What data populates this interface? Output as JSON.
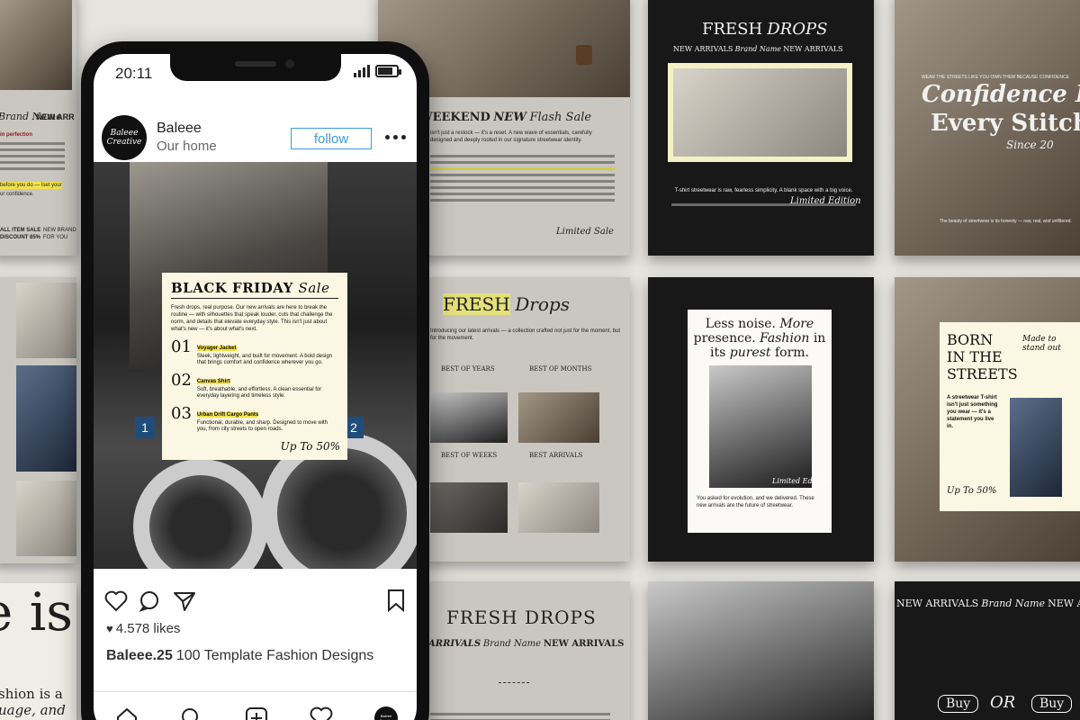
{
  "colors": {
    "accent": "#3d9be0",
    "highlight": "#f3e14b",
    "card": "#fbf7e2",
    "dark": "#181818"
  },
  "phone": {
    "time": "20:11",
    "account": {
      "name": "Baleee",
      "sub": "Our home",
      "avatar_text": "Baleee Creative",
      "follow": "follow"
    },
    "post": {
      "card_title": "BLACK FRIDAY",
      "card_title_script": "Sale",
      "intro": "Fresh drops, real purpose. Our new arrivals are here to break the routine — with silhouettes that speak louder, cuts that challenge the norm, and details that elevate everyday style. This isn't just about what's new — it's about what's next.",
      "items": [
        {
          "num": "01",
          "title": "Voyager Jacket",
          "desc": "Sleek, lightweight, and built for movement. A bold design that brings comfort and confidence wherever you go."
        },
        {
          "num": "02",
          "title": "Canvas Shirt",
          "desc": "Soft, breathable, and effortless. A clean essential for everyday layering and timeless style."
        },
        {
          "num": "03",
          "title": "Urban Drift Cargo Pants",
          "desc": "Functional, durable, and sharp. Designed to move with you, from city streets to open roads."
        }
      ],
      "upto": "Up To 50%",
      "badge_left": "1",
      "badge_right": "2"
    },
    "likes": "4.578 likes",
    "caption_user": "Baleee.25",
    "caption_text": "100 Template Fashion Designs"
  },
  "tiles": {
    "t1_title": "FRESH",
    "t1_script": "Drops",
    "t1_left_brand": "Brand Name",
    "t1_left_new": "NEW ARR",
    "t1_left_perf": "in perfection",
    "t1_left_before": "before you do — lset your",
    "t1_left_conf": "ur confidence.",
    "t1_flash_a": "WEEKEND",
    "t1_flash_b": "NEW",
    "t1_flash_c": "Flash Sale",
    "t1_flash_body": "isn't just a restock — it's a reset. A new wave of essentials, carefully designed and deeply rooted in our signature streetwear identity.",
    "t1_sign": "Limited Sale",
    "fd_title": "FRESH",
    "fd_script": "Drops",
    "fd_intro": "Introducing our latest arrivals — a collection crafted not just for the moment, but for the movement.",
    "fd_best1": "BEST OF YEARS",
    "fd_best2": "BEST OF MONTHS",
    "fd_best3": "BEST OF WEEKS",
    "fd_best4": "BEST ARRIVALS",
    "fd2_title": "FRESH DROPS",
    "fd2_sub": "ARRIVALS",
    "fd2_brand": "Brand Name",
    "fd2_new": "NEW ARRIVALS",
    "d1_title": "FRESH",
    "d1_script": "DROPS",
    "d1_new": "NEW ARRIVALS",
    "d1_brand": "Brand Name",
    "d1_new2": "NEW ARRIVALS",
    "d1_body": "T-shirt streetwear is raw, fearless simplicity. A blank space with a big voice.",
    "d1_sign": "Limited Edition",
    "c1_line": "WEAR THE STREETS LIKE YOU OWN THEM BECAUSE CONFIDENCE",
    "c1_title1": "Confidence I",
    "c1_title2": "Every Stitch",
    "c1_since": "Since 20",
    "c1_body": "The beauty of streetwear is its honesty — raw, real, and unfiltered.",
    "ln_line1": "Less noise.",
    "ln_line1b": "More",
    "ln_line2": "presence.",
    "ln_line2b": "Fashion",
    "ln_line2c": "in",
    "ln_line3": "its",
    "ln_line3b": "purest",
    "ln_line3c": "form.",
    "ln_sign": "Limited Edition",
    "ln_body": "You asked for evolution, and we delivered. These new arrivals are the future of streetwear.",
    "bs_title1": "BORN",
    "bs_title2": "IN THE",
    "bs_title3": "STREETS",
    "bs_script": "Made to stand out",
    "bs_body": "A streetwear T-shirt isn't just something you wear — it's a statement you live in.",
    "bs_upto": "Up To 50%",
    "na_new": "NEW ARRIVALS",
    "na_brand": "Brand Name",
    "na_new2": "NEW ARRIVALS",
    "na_buy1": "Buy",
    "na_or": "OR",
    "na_buy2": "Buy",
    "isb_big": "e is",
    "isb_line1": "shion is a",
    "isb_line2": "uage, and",
    "left_brand_a": "NEW BRAND",
    "left_brand_b": "FOR YOU",
    "left_sale_a": "ALL ITEM SALE",
    "left_sale_b": "DISCOUNT 85%"
  }
}
